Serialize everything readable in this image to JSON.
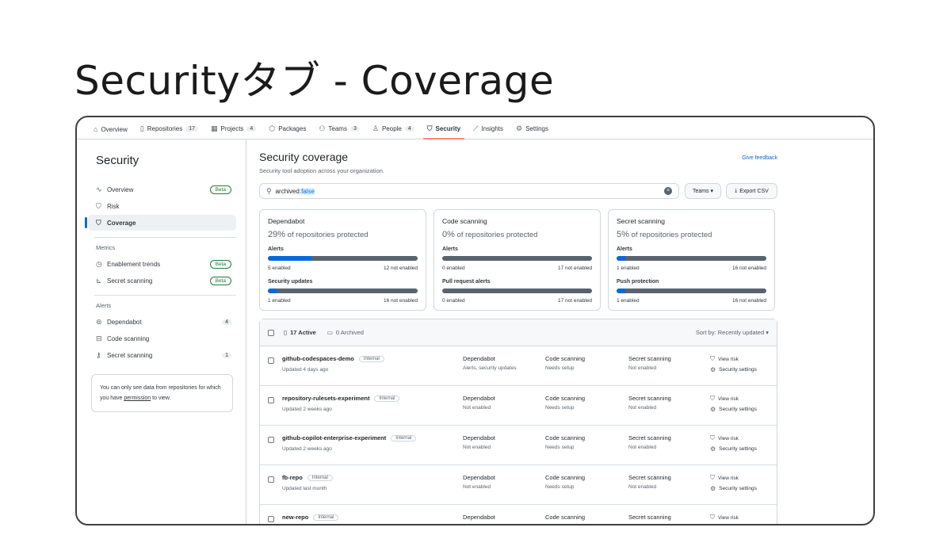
{
  "slide": {
    "title": "Securityタブ - Coverage"
  },
  "nav": [
    {
      "icon": "home-icon",
      "glyph": "⌂",
      "label": "Overview",
      "count": ""
    },
    {
      "icon": "repo-icon",
      "glyph": "▯",
      "label": "Repositories",
      "count": "17"
    },
    {
      "icon": "table-icon",
      "glyph": "▦",
      "label": "Projects",
      "count": "4"
    },
    {
      "icon": "package-icon",
      "glyph": "⬡",
      "label": "Packages",
      "count": ""
    },
    {
      "icon": "people-icon",
      "glyph": "⚇",
      "label": "Teams",
      "count": "3"
    },
    {
      "icon": "person-icon",
      "glyph": "♙",
      "label": "People",
      "count": "4"
    },
    {
      "icon": "shield-icon",
      "glyph": "⛉",
      "label": "Security",
      "count": ""
    },
    {
      "icon": "graph-icon",
      "glyph": "⟋",
      "label": "Insights",
      "count": ""
    },
    {
      "icon": "gear-icon",
      "glyph": "⚙",
      "label": "Settings",
      "count": ""
    }
  ],
  "sidebar": {
    "title": "Security",
    "items": [
      {
        "icon": "pulse-icon",
        "glyph": "∿",
        "label": "Overview",
        "badge": "Beta"
      },
      {
        "icon": "risk-shield-icon",
        "glyph": "⛉",
        "label": "Risk",
        "badge": ""
      },
      {
        "icon": "coverage-shield-icon",
        "glyph": "⛉",
        "label": "Coverage",
        "badge": ""
      }
    ],
    "metrics_heading": "Metrics",
    "metrics": [
      {
        "icon": "clock-icon",
        "glyph": "◷",
        "label": "Enablement trends",
        "badge": "Beta"
      },
      {
        "icon": "chart-icon",
        "glyph": "⊾",
        "label": "Secret scanning",
        "badge": "Beta"
      }
    ],
    "alerts_heading": "Alerts",
    "alerts": [
      {
        "icon": "dependabot-icon",
        "glyph": "⊚",
        "label": "Dependabot",
        "count": "4"
      },
      {
        "icon": "codescan-icon",
        "glyph": "⊟",
        "label": "Code scanning",
        "count": ""
      },
      {
        "icon": "key-icon",
        "glyph": "⚷",
        "label": "Secret scanning",
        "count": "1"
      }
    ],
    "note_prefix": "You can only see data from repositories for which you have ",
    "note_link": "permission",
    "note_suffix": " to view."
  },
  "main": {
    "title": "Security coverage",
    "subtitle": "Security tool adoption across your organization.",
    "feedback": "Give feedback",
    "search_key": "archived:",
    "search_value": "false",
    "teams_button": "Teams ▾",
    "export_button": "Export CSV"
  },
  "cards": [
    {
      "title": "Dependabot",
      "pct": "29%",
      "pct_text": " of repositories protected",
      "metrics": [
        {
          "label": "Alerts",
          "fraction": 0.29,
          "left": "5 enabled",
          "right": "12 not enabled"
        },
        {
          "label": "Security updates",
          "fraction": 0.06,
          "left": "1 enabled",
          "right": "16 not enabled"
        }
      ]
    },
    {
      "title": "Code scanning",
      "pct": "0%",
      "pct_text": " of repositories protected",
      "metrics": [
        {
          "label": "Alerts",
          "fraction": 0.0,
          "left": "0 enabled",
          "right": "17 not enabled"
        },
        {
          "label": "Pull request alerts",
          "fraction": 0.0,
          "left": "0 enabled",
          "right": "17 not enabled"
        }
      ]
    },
    {
      "title": "Secret scanning",
      "pct": "5%",
      "pct_text": " of repositories protected",
      "metrics": [
        {
          "label": "Alerts",
          "fraction": 0.06,
          "left": "1 enabled",
          "right": "16 not enabled"
        },
        {
          "label": "Push protection",
          "fraction": 0.06,
          "left": "1 enabled",
          "right": "16 not enabled"
        }
      ]
    }
  ],
  "list": {
    "active": "17 Active",
    "archived": "0 Archived",
    "sort": "Sort by: Recently updated ▾",
    "rows": [
      {
        "name": "github-codespaces-demo",
        "visibility": "Internal",
        "updated": "Updated 4 days ago",
        "dep": "Dependabot",
        "dep_s": "Alerts, security updates",
        "code": "Code scanning",
        "code_s": "Needs setup",
        "secret": "Secret scanning",
        "secret_s": "Not enabled",
        "a1": "View risk",
        "a2": "Security settings"
      },
      {
        "name": "repository-rulesets-experiment",
        "visibility": "Internal",
        "updated": "Updated 2 weeks ago",
        "dep": "Dependabot",
        "dep_s": "Not enabled",
        "code": "Code scanning",
        "code_s": "Needs setup",
        "secret": "Secret scanning",
        "secret_s": "Not enabled",
        "a1": "View risk",
        "a2": "Security settings"
      },
      {
        "name": "github-copilot-enterprise-experiment",
        "visibility": "Internal",
        "updated": "Updated 2 weeks ago",
        "dep": "Dependabot",
        "dep_s": "Not enabled",
        "code": "Code scanning",
        "code_s": "Needs setup",
        "secret": "Secret scanning",
        "secret_s": "Not enabled",
        "a1": "View risk",
        "a2": "Security settings"
      },
      {
        "name": "fb-repo",
        "visibility": "Internal",
        "updated": "Updated last month",
        "dep": "Dependabot",
        "dep_s": "Not enabled",
        "code": "Code scanning",
        "code_s": "Needs setup",
        "secret": "Secret scanning",
        "secret_s": "Not enabled",
        "a1": "View risk",
        "a2": "Security settings"
      },
      {
        "name": "new-repo",
        "visibility": "Internal",
        "updated": "",
        "dep": "Dependabot",
        "dep_s": "",
        "code": "Code scanning",
        "code_s": "",
        "secret": "Secret scanning",
        "secret_s": "",
        "a1": "View risk",
        "a2": ""
      }
    ]
  },
  "colors": {
    "accent": "#0969da",
    "tab_underline": "#fd8c73",
    "beta": "#1a7f37",
    "bar_track": "#59636e"
  }
}
